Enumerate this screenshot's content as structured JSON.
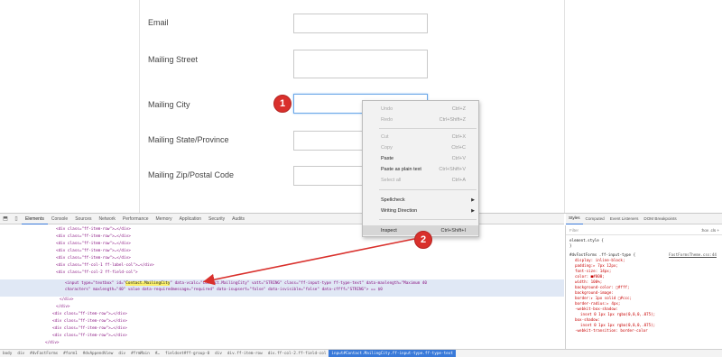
{
  "form": {
    "fields": [
      {
        "label": "Email"
      },
      {
        "label": "Mailing Street"
      },
      {
        "label": "Mailing City"
      },
      {
        "label": "Mailing State/Province"
      },
      {
        "label": "Mailing Zip/Postal Code"
      }
    ]
  },
  "annotations": {
    "step1": "1",
    "step2": "2",
    "arrow_color": "#d9302c"
  },
  "context_menu": {
    "items": [
      {
        "label": "Undo",
        "shortcut": "Ctrl+Z",
        "disabled": true
      },
      {
        "label": "Redo",
        "shortcut": "Ctrl+Shift+Z",
        "disabled": true
      },
      {
        "label": "Cut",
        "shortcut": "Ctrl+X",
        "disabled": true
      },
      {
        "label": "Copy",
        "shortcut": "Ctrl+C",
        "disabled": true
      },
      {
        "label": "Paste",
        "shortcut": "Ctrl+V",
        "disabled": false
      },
      {
        "label": "Paste as plain text",
        "shortcut": "Ctrl+Shift+V",
        "disabled": false
      },
      {
        "label": "Select all",
        "shortcut": "Ctrl+A",
        "disabled": true
      },
      {
        "label": "Spellcheck",
        "shortcut": "",
        "disabled": false,
        "submenu": true
      },
      {
        "label": "Writing Direction",
        "shortcut": "",
        "disabled": false,
        "submenu": true
      },
      {
        "label": "Inspect",
        "shortcut": "Ctrl+Shift+I",
        "disabled": false,
        "highlighted": true
      }
    ]
  },
  "devtools": {
    "tabs": [
      "Elements",
      "Console",
      "Sources",
      "Network",
      "Performance",
      "Memory",
      "Application",
      "Security",
      "Audits"
    ],
    "active_tab": "Elements",
    "code": [
      "<div class=\"ff-item-row\">…</div>",
      "<div class=\"ff-item-row\">…</div>",
      "<div class=\"ff-item-row\">…</div>",
      "<div class=\"ff-item-row\">…</div>",
      "<div class=\"ff-item-row\">…</div>",
      "<div class=\"ff-col-1 ff-label-col\">…</div>",
      "<div class=\"ff-col-2 ff-field-col\">",
      "<input type=\"textbox\" id=\"",
      "Contact.MailingCity",
      "\" data-vcalc=\"Contact.MailingCity\" vatt=\"STRING\" class=\"ff-input-type ff-type-text\" data-maxlength=\"Maximum 40",
      "characters\" maxlength=\"40\" value data-requiredmessage=\"required\" data-isupsert=\"false\" data-isvisible=\"false\" data-cffff=\"STRING\"> == $0",
      "</div>",
      "</div>",
      "<div class=\"ff-item-row\">…</div>",
      "<div class=\"ff-item-row\">…</div>",
      "<div class=\"ff-item-row\">…</div>",
      "<div class=\"ff-item-row\">…</div>",
      "</div>",
      "<div class=\"ff-footer-group\">…</div>",
      "</div>",
      "</div>"
    ],
    "styles": {
      "tabs": [
        "Styles",
        "Computed",
        "Event Listeners",
        "DOM Breakpoints"
      ],
      "filter_placeholder": "Filter",
      "filter_right": ":hov .cls +",
      "lines": [
        "element.style {",
        "}",
        "#dvFastForms .ff-input-type {",
        "display: inline-block;",
        "padding:▸ 7px 12px;",
        "font-size: 14px;",
        "color: ■#000;",
        "width: 100%;",
        "background-color: □#fff;",
        "background-image:",
        "border:▸ 1px solid □#ccc;",
        "border-radius:▸ 4px;",
        "-webkit-box-shadow:",
        "inset 0 1px 1px rgba(0,0,0,.075);",
        "box-shadow:",
        "inset 0 1px 1px rgba(0,0,0,.075);",
        "-webkit-transition: border-color"
      ],
      "source_link": "FastFormsTheme.css:44"
    },
    "breadcrumbs": [
      "body",
      "div",
      "#dvFastForms",
      "#form1",
      "#dvAppendView",
      "div",
      "#frmMain",
      "#…",
      "fieldset#ff-group-0",
      "div",
      "div.ff-item-row",
      "div.ff-col-2.ff-field-col",
      "input#Contact.MailingCity.ff-input-type.ff-type-text"
    ]
  }
}
